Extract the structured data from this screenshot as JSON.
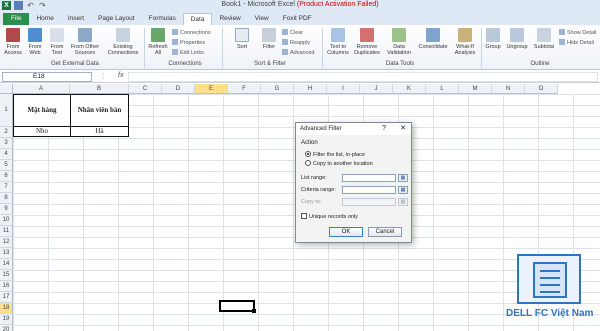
{
  "window": {
    "title_main": "Book1 - Microsoft Excel",
    "title_warning": "(Product Activation Failed)",
    "logo_letter": "X"
  },
  "tabs": [
    "File",
    "Home",
    "Insert",
    "Page Layout",
    "Formulas",
    "Data",
    "Review",
    "View",
    "Foxit PDF"
  ],
  "active_tab": "Data",
  "ribbon": {
    "get_external_data": {
      "label": "Get External Data",
      "buttons": [
        "From Access",
        "From Web",
        "From Text",
        "From Other Sources",
        "Existing Connections"
      ]
    },
    "connections": {
      "label": "Connections",
      "refresh": "Refresh All",
      "items": [
        "Connections",
        "Properties",
        "Edit Links"
      ]
    },
    "sort_filter": {
      "label": "Sort & Filter",
      "sort": "Sort",
      "filter": "Filter",
      "items": [
        "Clear",
        "Reapply",
        "Advanced"
      ]
    },
    "data_tools": {
      "label": "Data Tools",
      "buttons": [
        "Text to Columns",
        "Remove Duplicates",
        "Data Validation",
        "Consolidate",
        "What-If Analysis"
      ]
    },
    "outline": {
      "label": "Outline",
      "buttons": [
        "Group",
        "Ungroup",
        "Subtotal"
      ],
      "items": [
        "Show Detail",
        "Hide Detail"
      ]
    }
  },
  "formula_bar": {
    "name_box": "E18",
    "fx": "fx",
    "value": ""
  },
  "columns": [
    "A",
    "B",
    "C",
    "D",
    "E",
    "F",
    "G",
    "H",
    "I",
    "J",
    "K",
    "L",
    "M",
    "N",
    "O"
  ],
  "rows": [
    "1",
    "2",
    "3",
    "4",
    "5",
    "6",
    "7",
    "8",
    "9",
    "10",
    "11",
    "12",
    "13",
    "14",
    "15",
    "16",
    "17",
    "18",
    "19",
    "20"
  ],
  "selected": {
    "column": "E",
    "row": "18"
  },
  "sheet": {
    "A1": "Mặt hàng",
    "B1": "Nhân viên bán",
    "A2": "Nho",
    "B2": "Hà"
  },
  "dialog": {
    "title": "Advanced Filter",
    "help": "?",
    "close": "✕",
    "action_label": "Action",
    "radio_filter": "Filter the list, in-place",
    "radio_copy": "Copy to another location",
    "list_range_label": "List range:",
    "criteria_range_label": "Criteria range:",
    "copy_to_label": "Copy to:",
    "list_range_value": "",
    "criteria_range_value": "",
    "copy_to_value": "",
    "unique_label": "Unique records only",
    "ok": "OK",
    "cancel": "Cancel"
  },
  "watermark": {
    "brand": "DELL FC Việt Nam"
  },
  "colors": {
    "file_tab": "#2a8f4a",
    "selection_header": "#ffe08a",
    "brand": "#2f74c0"
  }
}
